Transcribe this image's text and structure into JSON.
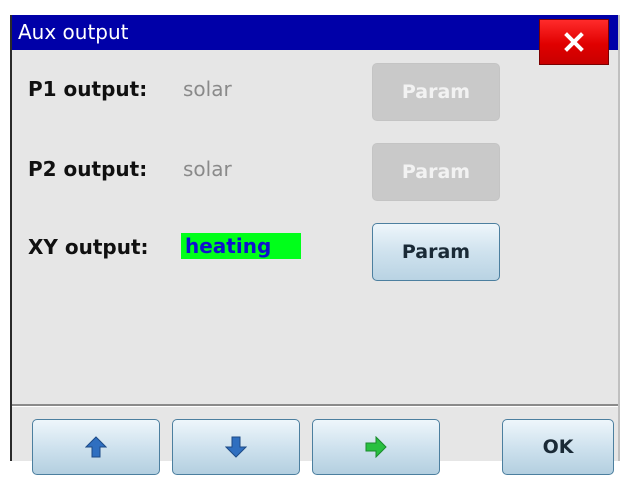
{
  "window": {
    "title": "Aux output"
  },
  "rows": [
    {
      "label": "P1 output:",
      "value": "solar",
      "button": "Param",
      "button_state": "disabled"
    },
    {
      "label": "P2 output:",
      "value": "solar",
      "button": "Param",
      "button_state": "disabled"
    },
    {
      "label": "XY output:",
      "value": "heating",
      "button": "Param",
      "button_state": "enabled"
    }
  ],
  "bottom": {
    "up_icon": "arrow-up-icon",
    "down_icon": "arrow-down-icon",
    "next_icon": "arrow-right-icon",
    "ok_label": "OK"
  },
  "colors": {
    "titlebar": "#0000a8",
    "close_button": "#e00000",
    "highlight_value_bg": "#00ff1a",
    "highlight_value_text": "#1010d0",
    "nav_arrow_blue": "#2f6fc0",
    "nav_arrow_green": "#28c040"
  }
}
